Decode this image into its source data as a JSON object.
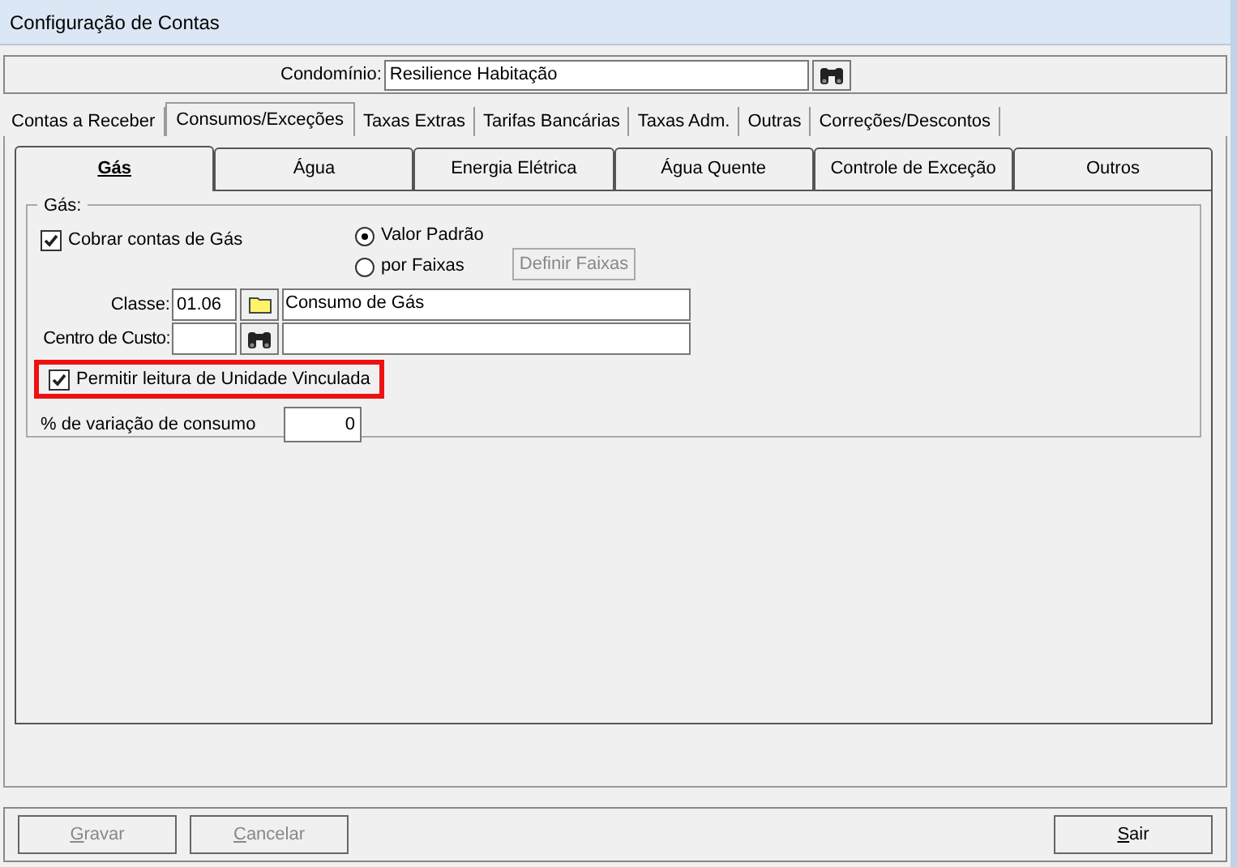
{
  "window": {
    "title": "Configuração de Contas"
  },
  "condominio": {
    "label": "Condomínio:",
    "value": "Resilience Habitação"
  },
  "tabs": [
    {
      "label": "Contas a Receber",
      "selected": false
    },
    {
      "label": "Consumos/Exceções",
      "selected": true
    },
    {
      "label": "Taxas Extras",
      "selected": false
    },
    {
      "label": "Tarifas Bancárias",
      "selected": false
    },
    {
      "label": "Taxas Adm.",
      "selected": false
    },
    {
      "label": "Outras",
      "selected": false
    },
    {
      "label": "Correções/Descontos",
      "selected": false
    }
  ],
  "subtabs": [
    {
      "label": "Gás",
      "selected": true
    },
    {
      "label": "Água",
      "selected": false
    },
    {
      "label": "Energia Elétrica",
      "selected": false
    },
    {
      "label": "Água Quente",
      "selected": false
    },
    {
      "label": "Controle de Exceção",
      "selected": false
    },
    {
      "label": "Outros",
      "selected": false
    }
  ],
  "group": {
    "title": "Gás:",
    "cobrar": {
      "label": "Cobrar contas de Gás",
      "checked": true
    },
    "radios": [
      {
        "label": "Valor Padrão",
        "selected": true
      },
      {
        "label": "por Faixas",
        "selected": false
      }
    ],
    "definir_button": {
      "label": "Definir Faixas",
      "disabled": true
    },
    "classe": {
      "label": "Classe:",
      "code": "01.06",
      "description": "Consumo de Gás"
    },
    "centro": {
      "label": "Centro de Custo:"
    },
    "permitir": {
      "label": "Permitir leitura de Unidade Vinculada",
      "checked": true,
      "highlighted": true
    },
    "variacao": {
      "label": "% de variação de consumo",
      "value": "0"
    }
  },
  "buttons": [
    {
      "label": "Gravar",
      "disabled": true
    },
    {
      "label": "Cancelar",
      "disabled": true
    },
    {
      "label": "Sair",
      "disabled": false
    }
  ]
}
